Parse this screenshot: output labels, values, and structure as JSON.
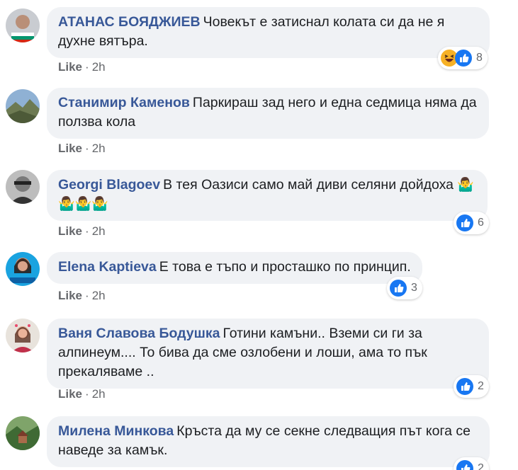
{
  "colors": {
    "author": "#385898",
    "bubble": "#f0f2f5",
    "meta": "#65676b",
    "like_blue": "#1877f2",
    "haha_yellow": "#f7b125"
  },
  "comments": [
    {
      "author": "АТАНАС БОЯДЖИЕВ",
      "text": "Човекът е затиснал колата си да не я духне вятъра.",
      "like": "Like",
      "time": "2h",
      "reactions": [
        "haha-icon",
        "like-icon"
      ],
      "reaction_count": "8"
    },
    {
      "author": "Станимир Каменов",
      "text": "Паркираш зад него и една седмица няма да ползва кола",
      "like": "Like",
      "time": "2h"
    },
    {
      "author": "Georgi Blagoev",
      "text": "В тея Оазиси само май диви селяни дойдоха",
      "emojis_inline": "🤷‍♂️",
      "emojis_line2": "🤷‍♂️🤷‍♂️🤷‍♂️",
      "like": "Like",
      "time": "2h",
      "reactions": [
        "like-icon"
      ],
      "reaction_count": "6"
    },
    {
      "author": "Elena Kaptieva",
      "text": "Е това е тъпо и просташко по принцип.",
      "like": "Like",
      "time": "2h",
      "reactions": [
        "like-icon"
      ],
      "reaction_count": "3"
    },
    {
      "author": "Ваня Славова Бодушка",
      "text": "Готини камъни.. Вземи си ги за алпинеум.... То бива да сме озлобени и лоши, ама то пък прекаляваме ..",
      "like": "Like",
      "time": "2h",
      "reactions": [
        "like-icon"
      ],
      "reaction_count": "2"
    },
    {
      "author": "Милена Минкова",
      "text": "Кръста да му се секне следващия път кога се наведе за камък.",
      "reactions": [
        "like-icon"
      ],
      "reaction_count": "2"
    }
  ]
}
